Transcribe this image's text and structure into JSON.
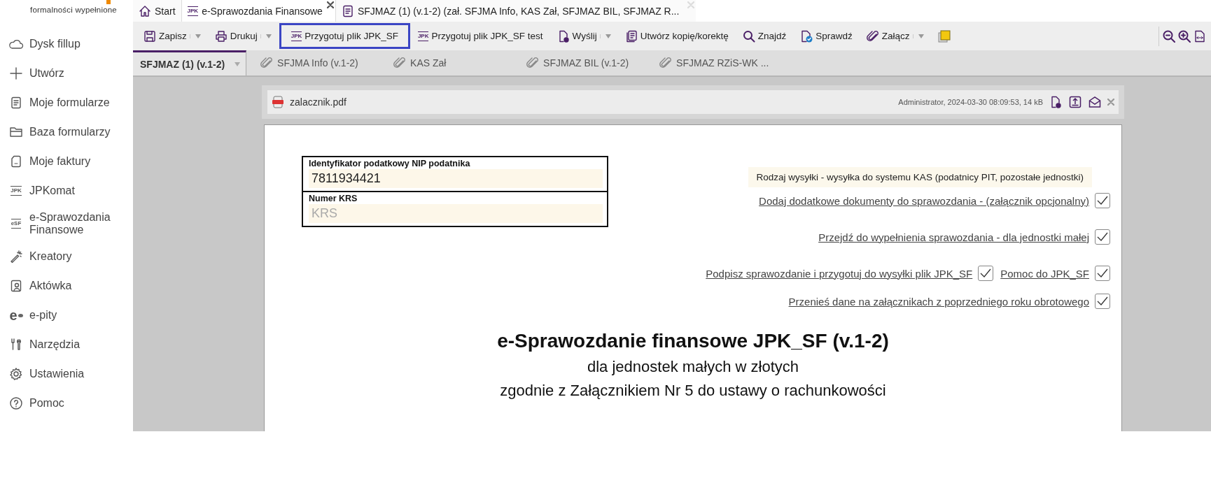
{
  "sidebar": {
    "logo_caption": "formalności wypełnione",
    "items": [
      {
        "kind": "cloud",
        "label": "Dysk fillup"
      },
      {
        "kind": "plus",
        "label": "Utwórz"
      },
      {
        "kind": "document",
        "label": "Moje formularze"
      },
      {
        "kind": "folder",
        "label": "Baza formularzy"
      },
      {
        "kind": "invoice",
        "label": "Moje faktury"
      },
      {
        "kind": "badge",
        "badge": "JPK",
        "label": "JPKomat"
      },
      {
        "kind": "badge",
        "badge": "eSF",
        "label": "e-Sprawozdania Finansowe"
      },
      {
        "kind": "wand",
        "label": "Kreatory"
      },
      {
        "kind": "contact",
        "label": "Aktówka"
      },
      {
        "kind": "letter",
        "badge": "e",
        "label": "e-pity"
      },
      {
        "kind": "tools",
        "label": "Narzędzia"
      },
      {
        "kind": "gear",
        "label": "Ustawienia"
      },
      {
        "kind": "help",
        "label": "Pomoc"
      }
    ]
  },
  "tabs": [
    {
      "kind": "home",
      "label": "Start",
      "selected": false,
      "closable": false
    },
    {
      "kind": "badge",
      "badge": "JPK",
      "label": "e-Sprawozdania Finansowe",
      "selected": true,
      "closable": true
    },
    {
      "kind": "document",
      "label": "SFJMAZ (1) (v.1-2) (zał. SFJMA Info, KAS Zał, SFJMAZ BIL, SFJMAZ R...",
      "selected": false,
      "closable": true
    }
  ],
  "toolbar": {
    "items": [
      {
        "kind": "save",
        "label": "Zapisz",
        "dropdown": true,
        "outlined": false
      },
      {
        "kind": "print",
        "label": "Drukuj",
        "dropdown": true,
        "outlined": false
      },
      {
        "kind": "badge",
        "badge": "JPK",
        "label": "Przygotuj plik JPK_SF",
        "dropdown": false,
        "outlined": true
      },
      {
        "kind": "badge",
        "badge": "JPK",
        "label": "Przygotuj plik JPK_SF test",
        "dropdown": false,
        "outlined": false
      },
      {
        "kind": "send",
        "label": "Wyślij",
        "dropdown": true,
        "outlined": false
      },
      {
        "kind": "copy",
        "label": "Utwórz kopię/korektę",
        "dropdown": false,
        "outlined": false
      },
      {
        "kind": "search",
        "label": "Znajdź",
        "dropdown": false,
        "outlined": false
      },
      {
        "kind": "check",
        "label": "Sprawdź",
        "dropdown": false,
        "outlined": false
      },
      {
        "kind": "clip",
        "label": "Załącz",
        "dropdown": true,
        "outlined": false
      },
      {
        "kind": "note",
        "dropdown": false,
        "outlined": false
      }
    ],
    "view_tools": [
      {
        "kind": "zoom-out"
      },
      {
        "kind": "zoom-in"
      },
      {
        "kind": "fit-width"
      }
    ]
  },
  "subtabs": [
    {
      "kind": "form",
      "label": "SFJMAZ (1) (v.1-2)",
      "selected": true
    },
    {
      "kind": "attachment",
      "label": "SFJMA Info (v.1-2)",
      "selected": false
    },
    {
      "kind": "attachment",
      "label": "KAS Zał",
      "selected": false
    },
    {
      "kind": "attachment",
      "label": "SFJMAZ BIL (v.1-2)",
      "selected": false
    },
    {
      "kind": "attachment",
      "label": "SFJMAZ RZiS-WK ...",
      "selected": false
    }
  ],
  "attachment": {
    "file_name": "zalacznik.pdf",
    "meta": "Administrator, 2024-03-30 08:09:53, 14 kB"
  },
  "form": {
    "fields": [
      {
        "label": "Identyfikator podatkowy NIP podatnika",
        "value": "7811934421"
      },
      {
        "label": "Numer KRS",
        "placeholder": "KRS"
      }
    ],
    "notice": "Rodzaj wysyłki - wysyłka do systemu KAS (podatnicy PIT, pozostałe jednostki)",
    "option_rows": [
      {
        "options": [
          {
            "label": "Dodaj dodatkowe dokumenty do sprawozdania - (załącznik opcjonalny)",
            "checked": true
          }
        ]
      },
      {
        "options": [
          {
            "label": "Przejdź do wypełnienia sprawozdania - dla jednostki małej",
            "checked": true
          }
        ]
      },
      {
        "options": [
          {
            "label": "Podpisz sprawozdanie i przygotuj do wysyłki plik JPK_SF",
            "checked": true
          },
          {
            "label": "Pomoc do JPK_SF",
            "checked": true
          }
        ]
      },
      {
        "options": [
          {
            "label": "Przenieś dane na załącznikach z poprzedniego roku obrotowego",
            "checked": true
          }
        ]
      }
    ],
    "title": "e-Sprawozdanie finansowe JPK_SF (v.1-2)",
    "subtitles": [
      "dla jednostek małych w złotych",
      "zgodnie z Załącznikiem Nr 5 do ustawy o rachunkowości"
    ]
  }
}
